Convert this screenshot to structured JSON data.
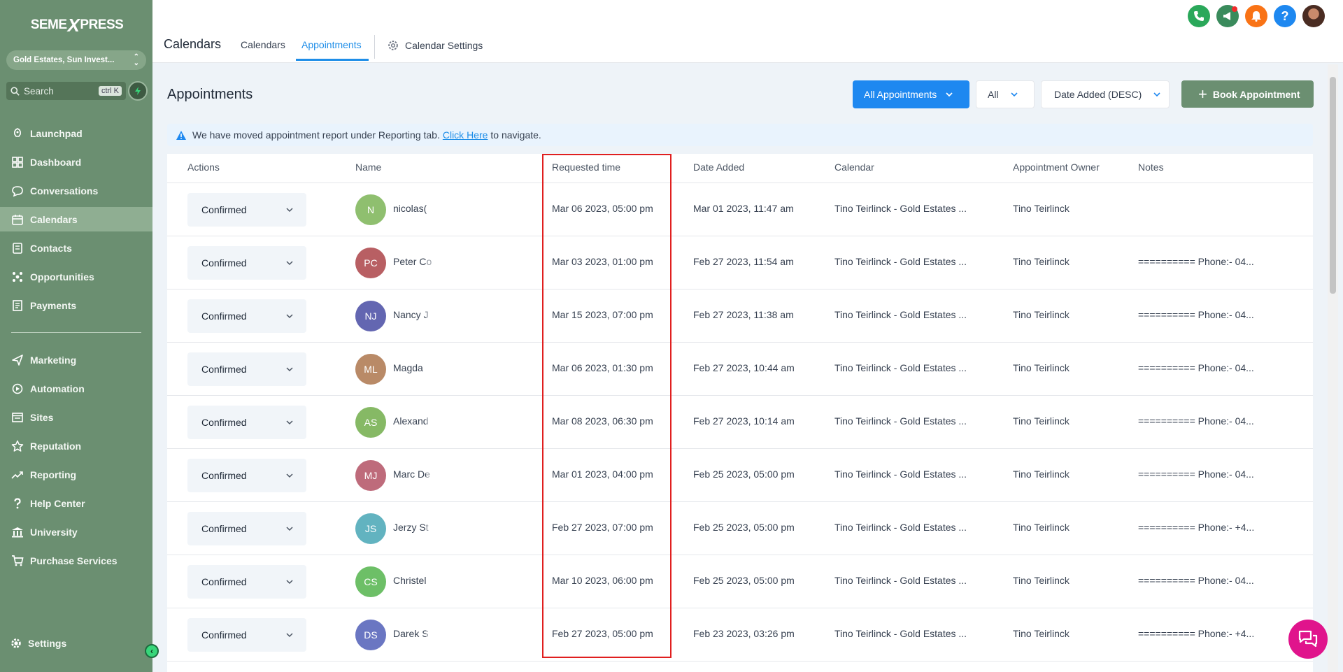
{
  "brand": {
    "logo_left": "SEME",
    "logo_x": "X",
    "logo_right": "PRESS"
  },
  "sidebar": {
    "account": "Gold Estates, Sun Invest...",
    "search_placeholder": "Search",
    "search_shortcut": "ctrl K",
    "items": [
      {
        "label": "Launchpad",
        "icon": "rocket-icon"
      },
      {
        "label": "Dashboard",
        "icon": "grid-icon"
      },
      {
        "label": "Conversations",
        "icon": "chat-icon"
      },
      {
        "label": "Calendars",
        "icon": "calendar-icon",
        "active": true
      },
      {
        "label": "Contacts",
        "icon": "contact-book-icon"
      },
      {
        "label": "Opportunities",
        "icon": "opportunities-icon"
      },
      {
        "label": "Payments",
        "icon": "payments-icon"
      }
    ],
    "items2": [
      {
        "label": "Marketing",
        "icon": "send-icon"
      },
      {
        "label": "Automation",
        "icon": "automation-icon"
      },
      {
        "label": "Sites",
        "icon": "sites-icon"
      },
      {
        "label": "Reputation",
        "icon": "star-icon"
      },
      {
        "label": "Reporting",
        "icon": "trend-icon"
      },
      {
        "label": "Help Center",
        "icon": "question-icon"
      },
      {
        "label": "University",
        "icon": "university-icon"
      },
      {
        "label": "Purchase Services",
        "icon": "cart-icon"
      }
    ],
    "settings": "Settings"
  },
  "header": {
    "title": "Calendars",
    "tabs": [
      "Calendars",
      "Appointments"
    ],
    "active_tab": "Appointments",
    "settings_tab": "Calendar Settings"
  },
  "main": {
    "title": "Appointments",
    "filter_primary": "All Appointments",
    "filter_status": "All",
    "sort": "Date Added (DESC)",
    "book_button": "Book Appointment",
    "banner": {
      "before": "We have moved appointment report under Reporting tab.",
      "link": "Click Here",
      "after": "to navigate."
    }
  },
  "table": {
    "columns": [
      "Actions",
      "Name",
      "Requested time",
      "Date Added",
      "Calendar",
      "Appointment Owner",
      "Notes"
    ],
    "rows": [
      {
        "status": "Confirmed",
        "initials": "N",
        "color": "#8fbf6f",
        "name": "nicolas(",
        "requested": "Mar 06 2023, 05:00 pm",
        "added": "Mar 01 2023, 11:47 am",
        "calendar": "Tino Teirlinck - Gold Estates ...",
        "owner": "Tino Teirlinck",
        "notes": ""
      },
      {
        "status": "Confirmed",
        "initials": "PC",
        "color": "#b85f63",
        "name": "Peter Co",
        "requested": "Mar 03 2023, 01:00 pm",
        "added": "Feb 27 2023, 11:54 am",
        "calendar": "Tino Teirlinck - Gold Estates ...",
        "owner": "Tino Teirlinck",
        "notes": "========== Phone:- 04..."
      },
      {
        "status": "Confirmed",
        "initials": "NJ",
        "color": "#6366b1",
        "name": "Nancy J",
        "requested": "Mar 15 2023, 07:00 pm",
        "added": "Feb 27 2023, 11:38 am",
        "calendar": "Tino Teirlinck - Gold Estates ...",
        "owner": "Tino Teirlinck",
        "notes": "========== Phone:- 04..."
      },
      {
        "status": "Confirmed",
        "initials": "ML",
        "color": "#b98a67",
        "name": "Magda",
        "requested": "Mar 06 2023, 01:30 pm",
        "added": "Feb 27 2023, 10:44 am",
        "calendar": "Tino Teirlinck - Gold Estates ...",
        "owner": "Tino Teirlinck",
        "notes": "========== Phone:- 04..."
      },
      {
        "status": "Confirmed",
        "initials": "AS",
        "color": "#86b965",
        "name": "Alexand",
        "requested": "Mar 08 2023, 06:30 pm",
        "added": "Feb 27 2023, 10:14 am",
        "calendar": "Tino Teirlinck - Gold Estates ...",
        "owner": "Tino Teirlinck",
        "notes": "========== Phone:- 04..."
      },
      {
        "status": "Confirmed",
        "initials": "MJ",
        "color": "#be6b7b",
        "name": "Marc De",
        "requested": "Mar 01 2023, 04:00 pm",
        "added": "Feb 25 2023, 05:00 pm",
        "calendar": "Tino Teirlinck - Gold Estates ...",
        "owner": "Tino Teirlinck",
        "notes": "========== Phone:- 04..."
      },
      {
        "status": "Confirmed",
        "initials": "JS",
        "color": "#62b3c0",
        "name": "Jerzy St",
        "requested": "Feb 27 2023, 07:00 pm",
        "added": "Feb 25 2023, 05:00 pm",
        "calendar": "Tino Teirlinck - Gold Estates ...",
        "owner": "Tino Teirlinck",
        "notes": "========== Phone:- +4..."
      },
      {
        "status": "Confirmed",
        "initials": "CS",
        "color": "#6dbf67",
        "name": "Christel",
        "requested": "Mar 10 2023, 06:00 pm",
        "added": "Feb 25 2023, 05:00 pm",
        "calendar": "Tino Teirlinck - Gold Estates ...",
        "owner": "Tino Teirlinck",
        "notes": "========== Phone:- 04..."
      },
      {
        "status": "Confirmed",
        "initials": "DS",
        "color": "#6a76c2",
        "name": "Darek S",
        "requested": "Feb 27 2023, 05:00 pm",
        "added": "Feb 23 2023, 03:26 pm",
        "calendar": "Tino Teirlinck - Gold Estates ...",
        "owner": "Tino Teirlinck",
        "notes": "========== Phone:- +4..."
      }
    ]
  },
  "colors": {
    "accent": "#1e88f0",
    "sidebar": "#6b8f71",
    "highlight": "#e01f1f",
    "chat": "#e0148c"
  }
}
